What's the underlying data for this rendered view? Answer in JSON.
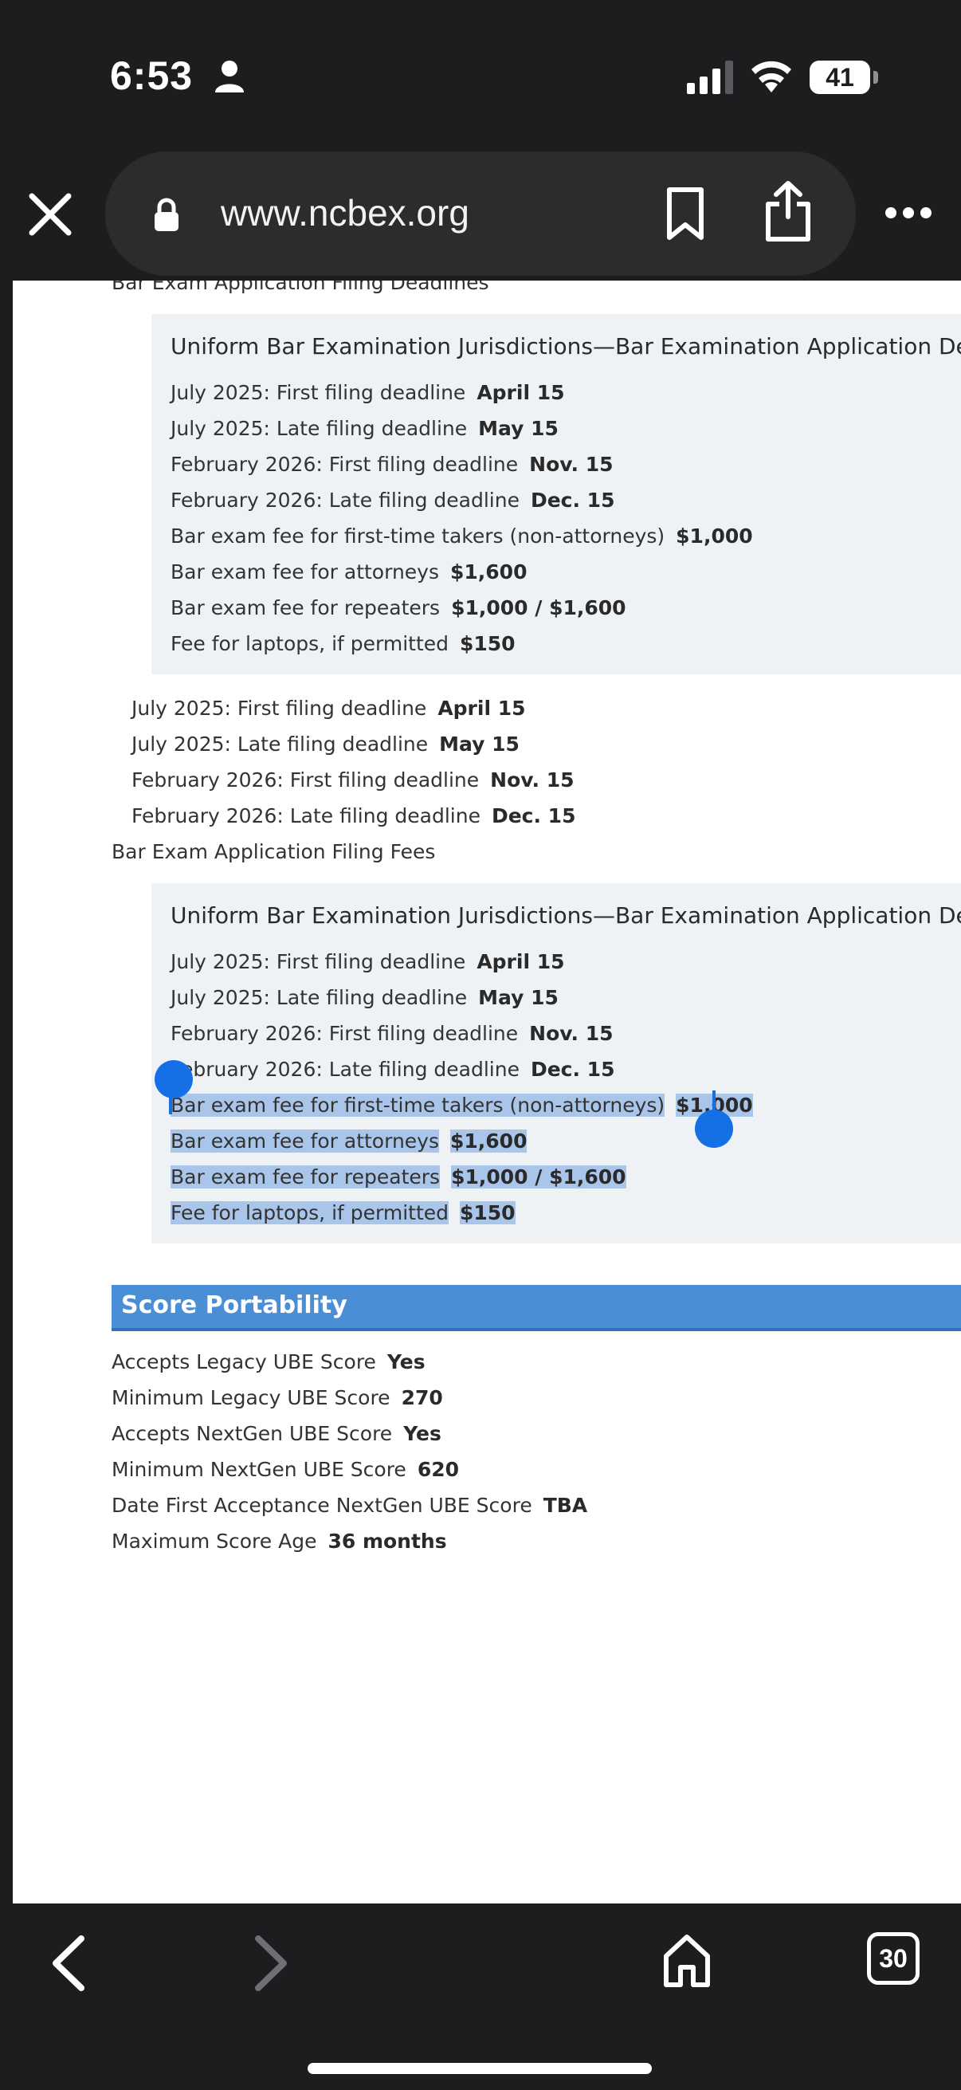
{
  "status": {
    "time": "6:53",
    "battery": "41"
  },
  "browser": {
    "url": "www.ncbex.org",
    "tab_count": "30"
  },
  "page": {
    "cropped_header": "Bar Exam Application Filing Deadlines",
    "panel1": {
      "title": "Uniform Bar Examination Jurisdictions—Bar Examination Application Deadlines",
      "rows": [
        {
          "label": "July 2025: First filing deadline",
          "value": "April 15"
        },
        {
          "label": "July 2025: Late filing deadline",
          "value": "May 15"
        },
        {
          "label": "February 2026: First filing deadline",
          "value": "Nov. 15"
        },
        {
          "label": "February 2026: Late filing deadline",
          "value": "Dec. 15"
        },
        {
          "label": "Bar exam fee for first-time takers (non-attorneys)",
          "value": "$1,000"
        },
        {
          "label": "Bar exam fee for attorneys",
          "value": "$1,600"
        },
        {
          "label": "Bar exam fee for repeaters",
          "value": "$1,000 / $1,600"
        },
        {
          "label": "Fee for laptops, if permitted",
          "value": "$150"
        }
      ]
    },
    "deadlines": [
      {
        "label": "July 2025: First filing deadline",
        "value": "April 15"
      },
      {
        "label": "July 2025: Late filing deadline",
        "value": "May 15"
      },
      {
        "label": "February 2026: First filing deadline",
        "value": "Nov. 15"
      },
      {
        "label": "February 2026: Late filing deadline",
        "value": "Dec. 15"
      }
    ],
    "fees_heading": "Bar Exam Application Filing Fees",
    "panel2": {
      "title": "Uniform Bar Examination Jurisdictions—Bar Examination Application Deadlines",
      "rows": [
        {
          "label": "July 2025: First filing deadline",
          "value": "April 15"
        },
        {
          "label": "July 2025: Late filing deadline",
          "value": "May 15"
        },
        {
          "label": "February 2026: First filing deadline",
          "value": "Nov. 15"
        },
        {
          "label": "February 2026: Late filing deadline",
          "value": "Dec. 15"
        },
        {
          "label": "Bar exam fee for first-time takers (non-attorneys)",
          "value": "$1,000"
        },
        {
          "label": "Bar exam fee for attorneys",
          "value": "$1,600"
        },
        {
          "label": "Bar exam fee for repeaters",
          "value": "$1,000 / $1,600"
        },
        {
          "label": "Fee for laptops, if permitted",
          "value": "$150"
        }
      ]
    },
    "score_portability": {
      "title": "Score Portability",
      "rows": [
        {
          "label": "Accepts Legacy UBE Score",
          "value": "Yes"
        },
        {
          "label": "Minimum Legacy UBE Score",
          "value": "270"
        },
        {
          "label": "Accepts NextGen UBE Score",
          "value": "Yes"
        },
        {
          "label": "Minimum NextGen UBE Score",
          "value": "620"
        },
        {
          "label": "Date First Acceptance NextGen UBE Score",
          "value": "TBA"
        },
        {
          "label": "Maximum Score Age",
          "value": "36 months"
        }
      ]
    }
  },
  "colors": {
    "accent": "#4a8fd6",
    "selection": "#a9c6ea",
    "handle": "#1470e4",
    "panel": "#eef2f5"
  }
}
